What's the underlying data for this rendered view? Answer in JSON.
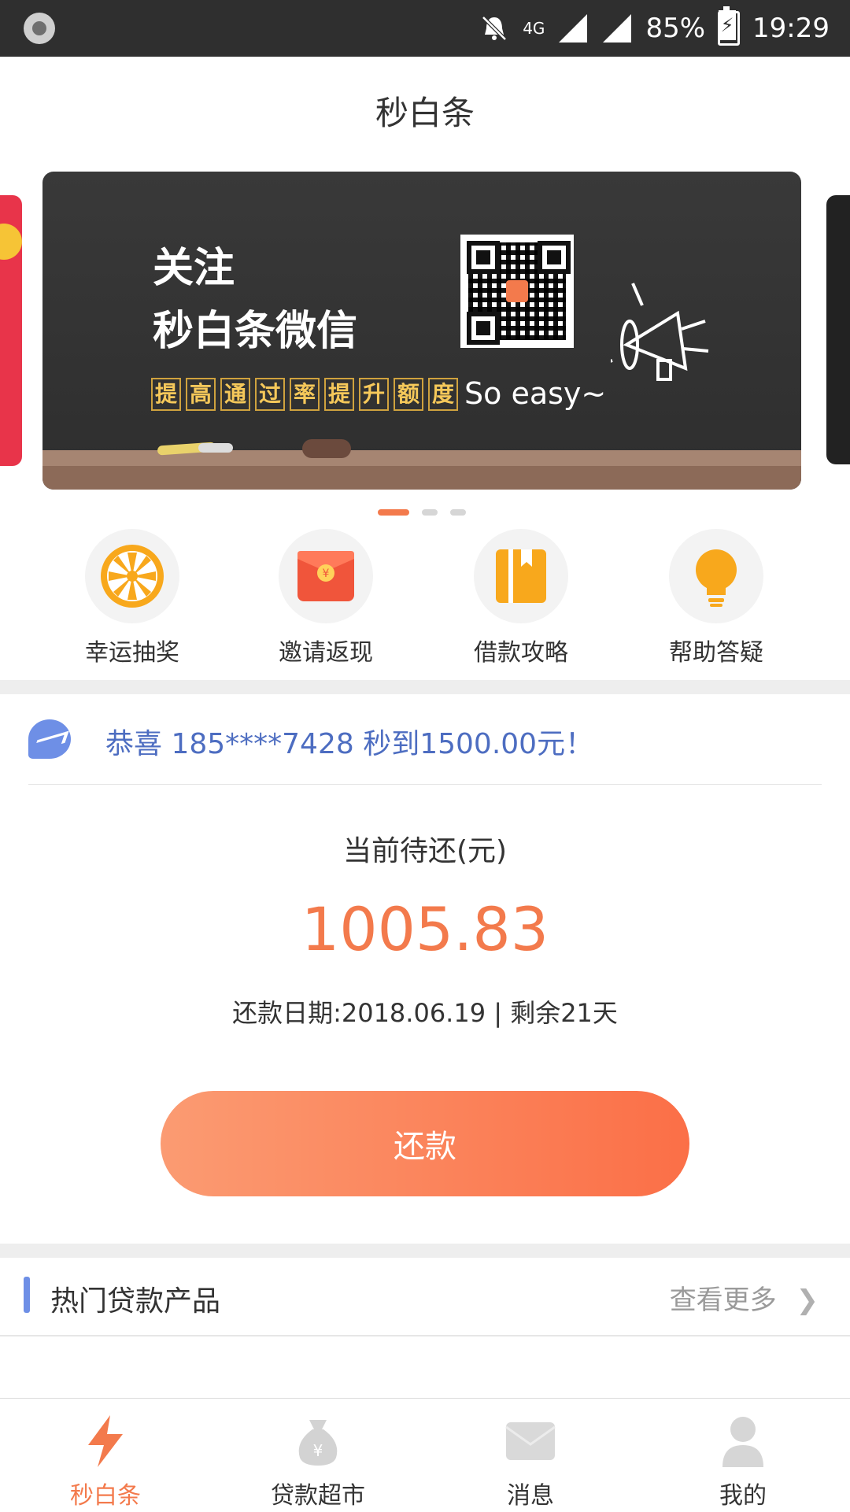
{
  "status_bar": {
    "network": "4G",
    "battery": "85%",
    "time": "19:29"
  },
  "header": {
    "title": "秒白条"
  },
  "banner": {
    "line1": "关注",
    "line2": "秒白条微信",
    "tags": [
      "提",
      "高",
      "通",
      "过",
      "率",
      "提",
      "升",
      "额",
      "度"
    ],
    "tagline": "So easy~",
    "page_count": 3,
    "active_page": 1
  },
  "quick_actions": [
    {
      "label": "幸运抽奖",
      "icon": "wheel-icon"
    },
    {
      "label": "邀请返现",
      "icon": "red-envelope-icon"
    },
    {
      "label": "借款攻略",
      "icon": "guide-book-icon"
    },
    {
      "label": "帮助答疑",
      "icon": "lightbulb-icon"
    }
  ],
  "notice": {
    "text": "恭喜 185****7428 秒到1500.00元！"
  },
  "due": {
    "title": "当前待还(元)",
    "amount": "1005.83",
    "date_line": "还款日期:2018.06.19 | 剩余21天",
    "button_label": "还款"
  },
  "hot_products": {
    "title": "热门贷款产品",
    "more": "查看更多"
  },
  "tabs": [
    {
      "label": "秒白条",
      "active": true
    },
    {
      "label": "贷款超市",
      "active": false
    },
    {
      "label": "消息",
      "active": false
    },
    {
      "label": "我的",
      "active": false
    }
  ],
  "colors": {
    "accent": "#f37a4c",
    "blue": "#4d6dc1",
    "status_bar": "#2f2f2f"
  }
}
